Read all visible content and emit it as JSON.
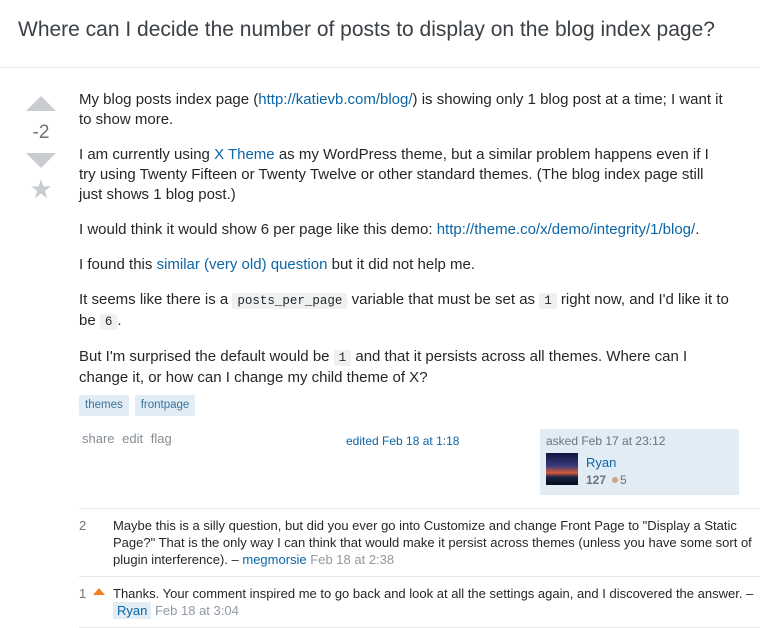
{
  "question": {
    "title": "Where can I decide the number of posts to display on the blog index page?",
    "score": "-2"
  },
  "body": {
    "p1_before": "My blog posts index page (",
    "p1_link": "http://katievb.com/blog/",
    "p1_after": ") is showing only 1 blog post at a time; I want it to show more.",
    "p2_before": "I am currently using ",
    "p2_link": "X Theme",
    "p2_after": " as my WordPress theme, but a similar problem happens even if I try using Twenty Fifteen or Twenty Twelve or other standard themes. (The blog index page still just shows 1 blog post.)",
    "p3_before": "I would think it would show 6 per page like this demo: ",
    "p3_link": "http://theme.co/x/demo/integrity/1/blog/",
    "p3_after": ".",
    "p4_before": "I found this ",
    "p4_link": "similar (very old) question",
    "p4_after": " but it did not help me.",
    "p5_a": "It seems like there is a ",
    "p5_code1": "posts_per_page",
    "p5_b": " variable that must be set as ",
    "p5_code2": "1",
    "p5_c": " right now, and I'd like it to be ",
    "p5_code3": "6",
    "p5_d": ".",
    "p6_a": "But I'm surprised the default would be ",
    "p6_code": "1",
    "p6_b": " and that it persists across all themes. Where can I change it, or how can I change my child theme of X?"
  },
  "tags": [
    "themes",
    "frontpage"
  ],
  "actions": {
    "share": "share",
    "edit": "edit",
    "flag": "flag"
  },
  "edited": "edited Feb 18 at 1:18",
  "owner": {
    "asked": "asked Feb 17 at 23:12",
    "name": "Ryan",
    "reputation": "127",
    "bronze": "5"
  },
  "comments": [
    {
      "score": "2",
      "text": "Maybe this is a silly question, but did you ever go into Customize and change Front Page to \"Display a Static Page?\" That is the only way I can think that would make it persist across themes (unless you have some sort of plugin interference). – ",
      "user": "megmorsie",
      "date": "Feb 18 at 2:38"
    },
    {
      "score": "1",
      "text": "Thanks. Your comment inspired me to go back and look at all the settings again, and I discovered the answer. – ",
      "user": "Ryan",
      "date": "Feb 18 at 3:04"
    }
  ],
  "colors": {
    "link": "#0c65a5",
    "tag_bg": "#e1ecf4",
    "tag_text": "#39739d",
    "upvote": "#f48024"
  }
}
